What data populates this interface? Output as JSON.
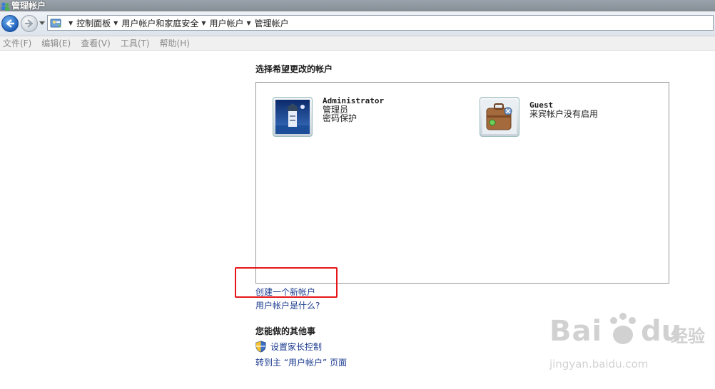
{
  "window": {
    "title": "管理帐户"
  },
  "address": {
    "crumbs": [
      {
        "label": "控制面板"
      },
      {
        "label": "用户帐户和家庭安全"
      },
      {
        "label": "用户帐户"
      },
      {
        "label": "管理帐户"
      }
    ]
  },
  "menu": [
    "文件(F)",
    "编辑(E)",
    "查看(V)",
    "工具(T)",
    "帮助(H)"
  ],
  "main": {
    "heading": "选择希望更改的帐户",
    "accounts": [
      {
        "name": "Administrator",
        "lines": [
          "管理员",
          "密码保护"
        ],
        "icon": "lighthouse-icon"
      },
      {
        "name": "Guest",
        "lines": [
          "来宾帐户没有启用"
        ],
        "icon": "suitcase-icon"
      }
    ],
    "links": {
      "create": "创建一个新帐户",
      "what_is": "用户帐户是什么?"
    },
    "other_heading": "您能做的其他事",
    "other_links": {
      "parental": "设置家长控制",
      "goto_main": "转到主 “用户帐户” 页面"
    }
  },
  "watermark": {
    "brand": "Bai",
    "brand2": "du",
    "cn": "经验",
    "url": "jingyan.baidu.com"
  },
  "colors": {
    "link": "#1d3c8f",
    "highlight": "#e5151a",
    "titlebar": "#8f979f"
  }
}
